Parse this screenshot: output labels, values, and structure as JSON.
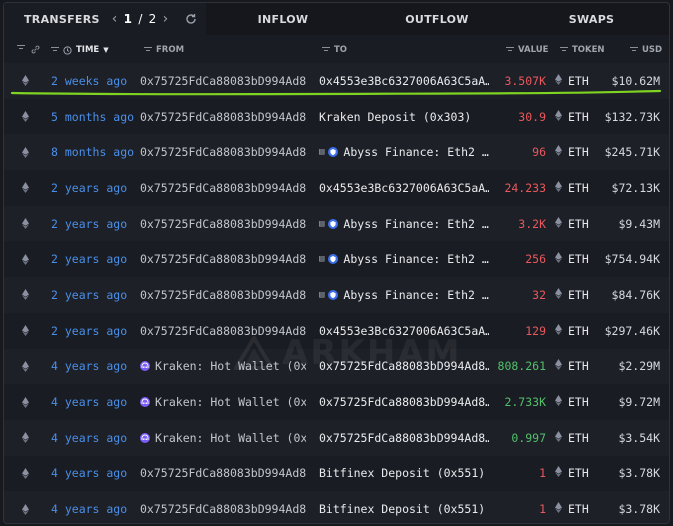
{
  "tabs": {
    "transfers": "TRANSFERS",
    "inflow": "INFLOW",
    "outflow": "OUTFLOW",
    "swaps": "SWAPS"
  },
  "pager": {
    "current": "1",
    "sep": "/",
    "total": "2"
  },
  "columns": {
    "time": "TIME",
    "from": "FROM",
    "to": "TO",
    "value": "VALUE",
    "token": "TOKEN",
    "usd": "USD"
  },
  "watermark": "ARKHAM",
  "colors": {
    "accent": "#4a8fe8",
    "negative": "#e8585c",
    "positive": "#52c06a",
    "highlight": "#7fd321"
  },
  "rows": [
    {
      "time": "2 weeks ago",
      "from": "0x75725FdCa88083bD994Ad8…",
      "to": "0x4553e3Bc6327006A63C5aA…",
      "to_entity": "",
      "value": "3.507K",
      "dir": "neg",
      "token": "ETH",
      "usd": "$10.62M"
    },
    {
      "time": "5 months ago",
      "from": "0x75725FdCa88083bD994Ad8…",
      "to": "Kraken Deposit (0x303)",
      "to_entity": "",
      "value": "30.9",
      "dir": "neg",
      "token": "ETH",
      "usd": "$132.73K"
    },
    {
      "time": "8 months ago",
      "from": "0x75725FdCa88083bD994Ad8…",
      "to": "Abyss Finance: Eth2 …",
      "to_entity": "abyss",
      "value": "96",
      "dir": "neg",
      "token": "ETH",
      "usd": "$245.71K"
    },
    {
      "time": "2 years ago",
      "from": "0x75725FdCa88083bD994Ad8…",
      "to": "0x4553e3Bc6327006A63C5aA…",
      "to_entity": "",
      "value": "24.233",
      "dir": "neg",
      "token": "ETH",
      "usd": "$72.13K"
    },
    {
      "time": "2 years ago",
      "from": "0x75725FdCa88083bD994Ad8…",
      "to": "Abyss Finance: Eth2 …",
      "to_entity": "abyss",
      "value": "3.2K",
      "dir": "neg",
      "token": "ETH",
      "usd": "$9.43M"
    },
    {
      "time": "2 years ago",
      "from": "0x75725FdCa88083bD994Ad8…",
      "to": "Abyss Finance: Eth2 …",
      "to_entity": "abyss",
      "value": "256",
      "dir": "neg",
      "token": "ETH",
      "usd": "$754.94K"
    },
    {
      "time": "2 years ago",
      "from": "0x75725FdCa88083bD994Ad8…",
      "to": "Abyss Finance: Eth2 …",
      "to_entity": "abyss",
      "value": "32",
      "dir": "neg",
      "token": "ETH",
      "usd": "$84.76K"
    },
    {
      "time": "2 years ago",
      "from": "0x75725FdCa88083bD994Ad8…",
      "to": "0x4553e3Bc6327006A63C5aA…",
      "to_entity": "",
      "value": "129",
      "dir": "neg",
      "token": "ETH",
      "usd": "$297.46K"
    },
    {
      "time": "4 years ago",
      "from": "Kraken: Hot Wallet (0x…",
      "from_entity": "kraken",
      "to": "0x75725FdCa88083bD994Ad8…",
      "to_entity": "",
      "value": "808.261",
      "dir": "pos",
      "token": "ETH",
      "usd": "$2.29M"
    },
    {
      "time": "4 years ago",
      "from": "Kraken: Hot Wallet (0x…",
      "from_entity": "kraken",
      "to": "0x75725FdCa88083bD994Ad8…",
      "to_entity": "",
      "value": "2.733K",
      "dir": "pos",
      "token": "ETH",
      "usd": "$9.72M"
    },
    {
      "time": "4 years ago",
      "from": "Kraken: Hot Wallet (0x…",
      "from_entity": "kraken",
      "to": "0x75725FdCa88083bD994Ad8…",
      "to_entity": "",
      "value": "0.997",
      "dir": "pos",
      "token": "ETH",
      "usd": "$3.54K"
    },
    {
      "time": "4 years ago",
      "from": "0x75725FdCa88083bD994Ad8…",
      "to": "Bitfinex Deposit (0x551)",
      "to_entity": "",
      "value": "1",
      "dir": "neg",
      "token": "ETH",
      "usd": "$3.78K"
    },
    {
      "time": "4 years ago",
      "from": "0x75725FdCa88083bD994Ad8…",
      "to": "Bitfinex Deposit (0x551)",
      "to_entity": "",
      "value": "1",
      "dir": "neg",
      "token": "ETH",
      "usd": "$3.78K"
    }
  ]
}
